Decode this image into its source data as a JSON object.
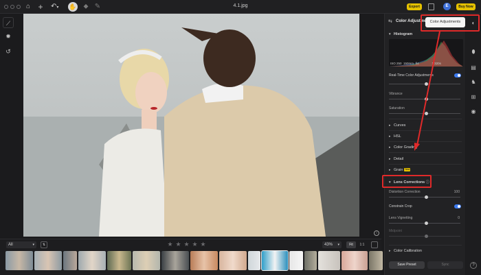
{
  "window": {
    "title": "4.1.jpg"
  },
  "toolbar": {
    "export_label": "Export",
    "avatar_letter": "E",
    "buy_label": "Buy Now"
  },
  "filmstrip": {
    "filter_value": "All",
    "zoom_value": "43%",
    "fit_label": "Fit",
    "one_to_one_label": "1:1",
    "star_count": 5
  },
  "panel": {
    "title": "Color Adjustments",
    "histogram": {
      "title": "Histogram",
      "iso": "ISO 250",
      "focal": "150mm",
      "aperture": "f/4",
      "shutter": "1/320s"
    },
    "realtime": {
      "label": "Real-Time Color Adjustments",
      "enabled": true
    },
    "vibrance": {
      "label": "Vibrance",
      "value": 0.5
    },
    "saturation": {
      "label": "Saturation",
      "value": 0.5
    },
    "sections": {
      "curves": "Curves",
      "hsl": "HSL",
      "color_grading": "Color Grading",
      "detail": "Detail",
      "grain": "Grain",
      "grain_badge": "New"
    },
    "lens": {
      "title": "Lens Corrections",
      "distortion_label": "Distortion Correction",
      "distortion_value": "100",
      "constrain_label": "Constrain Crop",
      "constrain_enabled": true,
      "vignetting_label": "Lens Vignetting",
      "vignetting_value": "0",
      "midpoint_label": "Midpoint"
    },
    "calibration": "Color Calibration",
    "save_preset": "Save Preset",
    "sync": "Sync"
  },
  "tooltip": {
    "text": "Color Adjustments"
  },
  "colors": {
    "accent": "#e6c200",
    "annotation": "#e02a2a",
    "toggle": "#3d7bf0"
  }
}
